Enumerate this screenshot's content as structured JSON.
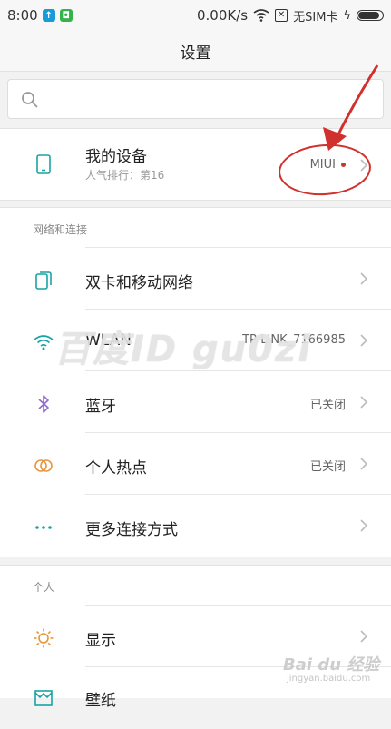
{
  "status_bar": {
    "time": "8:00",
    "network_speed": "0.00K/s",
    "sim_status": "无SIM卡",
    "battery_level_pct": 90,
    "icons": [
      "upload-icon",
      "alarm-icon",
      "wifi-icon",
      "no-sim-icon",
      "charging-icon",
      "battery-icon"
    ]
  },
  "header": {
    "title": "设置"
  },
  "search": {
    "placeholder": "",
    "value": ""
  },
  "device": {
    "label": "我的设备",
    "subtitle": "人气排行：第16",
    "value": "MIUI"
  },
  "sections": [
    {
      "title": "网络和连接",
      "items": [
        {
          "label": "双卡和移动网络",
          "value": "",
          "icon": "sim-card-icon"
        },
        {
          "label": "WLAN",
          "value": "TP-LINK_7166985",
          "icon": "wifi-icon"
        },
        {
          "label": "蓝牙",
          "value": "已关闭",
          "icon": "bluetooth-icon"
        },
        {
          "label": "个人热点",
          "value": "已关闭",
          "icon": "hotspot-icon"
        },
        {
          "label": "更多连接方式",
          "value": "",
          "icon": "more-dots-icon"
        }
      ]
    },
    {
      "title": "个人",
      "items": [
        {
          "label": "显示",
          "value": "",
          "icon": "brightness-icon"
        },
        {
          "label": "壁纸",
          "value": "",
          "icon": "wallpaper-icon"
        }
      ]
    }
  ],
  "watermark": {
    "text": "百度ID gu0zi",
    "brand": "Bai du 经验",
    "url": "jingyan.baidu.com"
  },
  "colors": {
    "accent_teal": "#1aa3a3",
    "annotation_red": "#d0312d",
    "bluetooth_purple": "#8f6bd0",
    "hotspot_orange": "#e8963a"
  }
}
